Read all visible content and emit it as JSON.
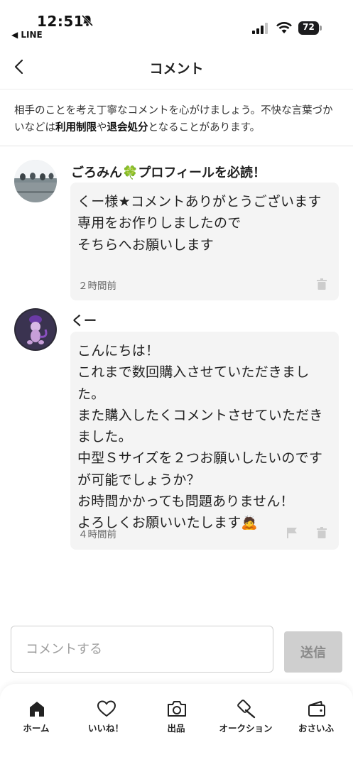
{
  "status_bar": {
    "time": "12:51",
    "back_app": "◀ LINE",
    "battery": "72"
  },
  "header": {
    "title": "コメント"
  },
  "notice": {
    "part1": "相手のことを考え丁寧なコメントを心がけましょう。不快な言葉づかいなどは",
    "bold1": "利用制限",
    "part2": "や",
    "bold2": "退会処分",
    "part3": "となることがあります。"
  },
  "comments": [
    {
      "name": "ごろみん🍀プロフィールを必読！",
      "text": "くー様★コメントありがとうございます\n専用をお作りしましたので\nそちらへお願いします",
      "time": "２時間前",
      "icons": [
        "trash-icon"
      ]
    },
    {
      "name": "くー",
      "text": "こんにちは！\nこれまで数回購入させていただきました。\nまた購入したくコメントさせていただきました。\n中型Ｓサイズを２つお願いしたいのですが可能でしょうか？\nお時間かかっても問題ありません！\nよろしくお願いいたします🙇",
      "time": "４時間前",
      "icons": [
        "flag-icon",
        "trash-icon"
      ]
    }
  ],
  "input": {
    "placeholder": "コメントする",
    "send_label": "送信"
  },
  "tabbar": {
    "items": [
      {
        "label": "ホーム",
        "icon": "home-icon"
      },
      {
        "label": "いいね！",
        "icon": "heart-icon"
      },
      {
        "label": "出品",
        "icon": "camera-icon"
      },
      {
        "label": "オークション",
        "icon": "gavel-icon"
      },
      {
        "label": "おさいふ",
        "icon": "wallet-icon"
      }
    ]
  },
  "colors": {
    "bubble_bg": "#f4f4f4",
    "send_disabled_bg": "#cfcfcf",
    "text": "#222222"
  }
}
